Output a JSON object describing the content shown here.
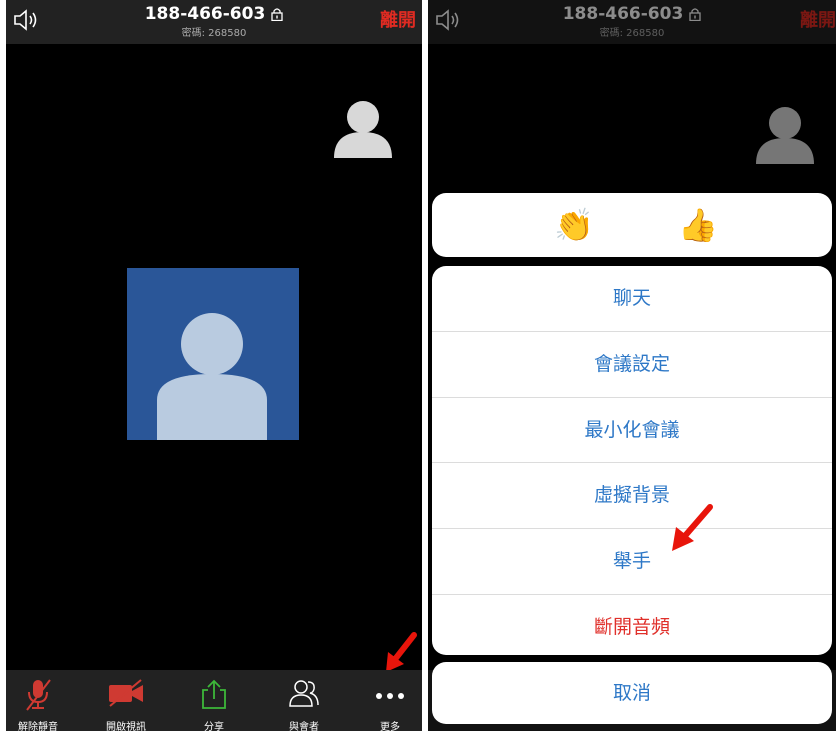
{
  "meeting": {
    "id": "188-466-603",
    "password": "密碼: 268580",
    "leave_label": "離開"
  },
  "toolbar": {
    "items": [
      {
        "label": "解除靜音",
        "icon": "muted-mic-icon"
      },
      {
        "label": "開啟視訊",
        "icon": "video-off-icon"
      },
      {
        "label": "分享",
        "icon": "share-icon"
      },
      {
        "label": "與會者",
        "icon": "participants-icon"
      },
      {
        "label": "更多",
        "icon": "more-icon"
      }
    ]
  },
  "reactions": [
    "👏",
    "👍"
  ],
  "menu": {
    "items": [
      {
        "label": "聊天"
      },
      {
        "label": "會議設定"
      },
      {
        "label": "最小化會議"
      },
      {
        "label": "虛擬背景"
      },
      {
        "label": "舉手"
      },
      {
        "label": "斷開音頻"
      }
    ],
    "cancel_label": "取消"
  },
  "colors": {
    "accent": "#2e78c7",
    "danger": "#e0302b",
    "video_tile": "#2a5698",
    "annotation_arrow": "#e8150b"
  }
}
